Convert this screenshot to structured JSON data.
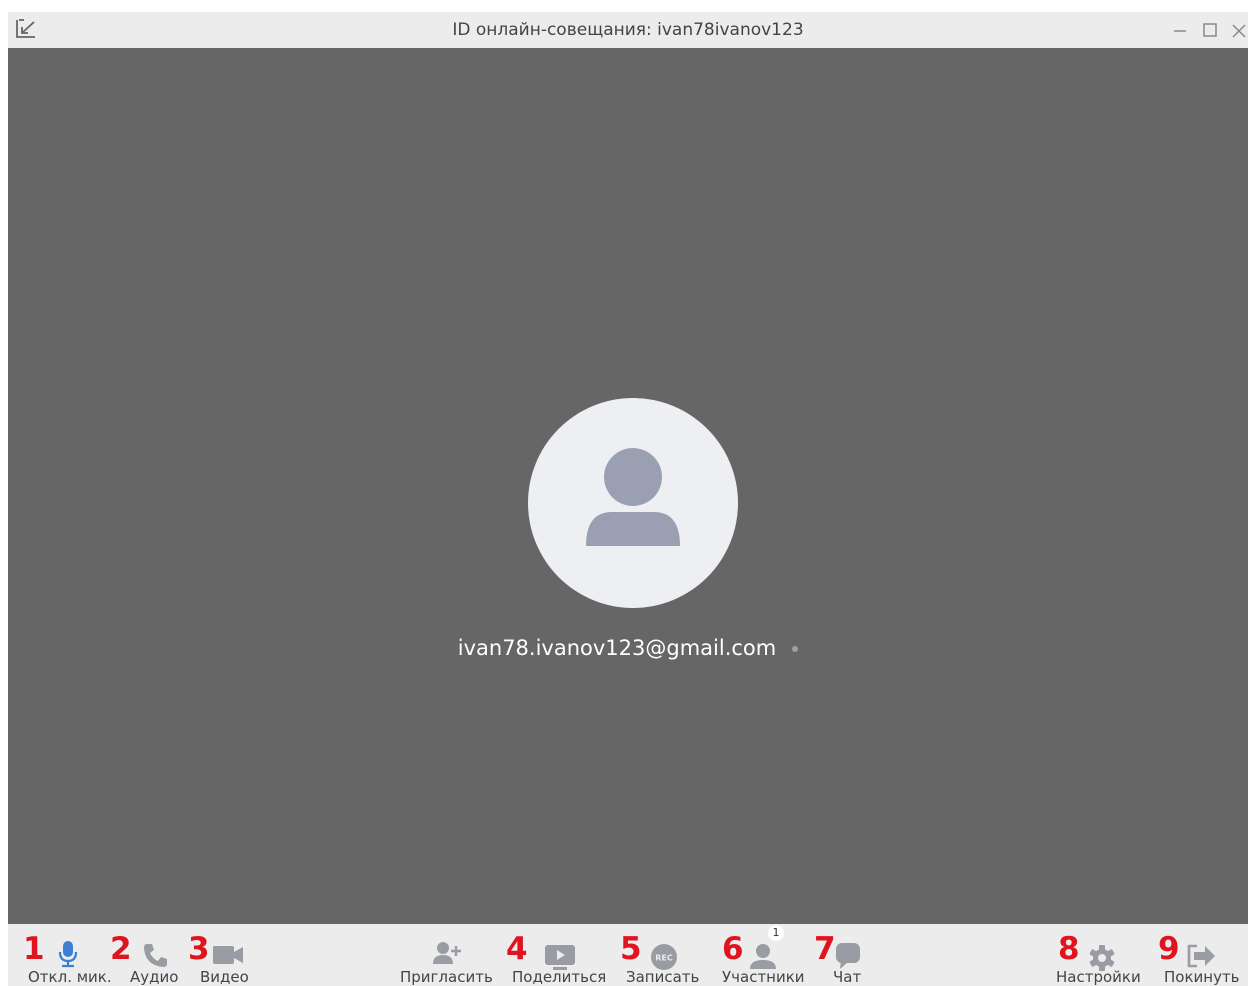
{
  "window": {
    "title": "ID онлайн-совещания: ivan78ivanov123"
  },
  "participant": {
    "name": "ivan78.ivanov123@gmail.com"
  },
  "toolbar": {
    "mute": {
      "label": "Откл. мик.",
      "marker": "1",
      "icon": "microphone-icon"
    },
    "audio": {
      "label": "Аудио",
      "marker": "2",
      "icon": "phone-icon"
    },
    "video": {
      "label": "Видео",
      "marker": "3",
      "icon": "camera-icon"
    },
    "invite": {
      "label": "Пригласить",
      "icon": "add-user-icon"
    },
    "share": {
      "label": "Поделиться",
      "marker": "4",
      "icon": "share-screen-icon"
    },
    "record": {
      "label": "Записать",
      "marker": "5",
      "icon": "record-icon",
      "icon_text": "REC"
    },
    "participants": {
      "label": "Участники",
      "marker": "6",
      "icon": "user-icon",
      "count": "1"
    },
    "chat": {
      "label": "Чат",
      "marker": "7",
      "icon": "chat-icon"
    },
    "settings": {
      "label": "Настройки",
      "marker": "8",
      "icon": "gear-icon"
    },
    "leave": {
      "label": "Покинуть",
      "marker": "9",
      "icon": "leave-icon"
    }
  },
  "colors": {
    "marker": "#e0141e",
    "accent_mic": "#3b7fd0",
    "icon_gray": "#9a9ca3",
    "video_bg": "#666666",
    "avatar_bg": "#eeeff2",
    "avatar_fg": "#9aa0b1"
  }
}
